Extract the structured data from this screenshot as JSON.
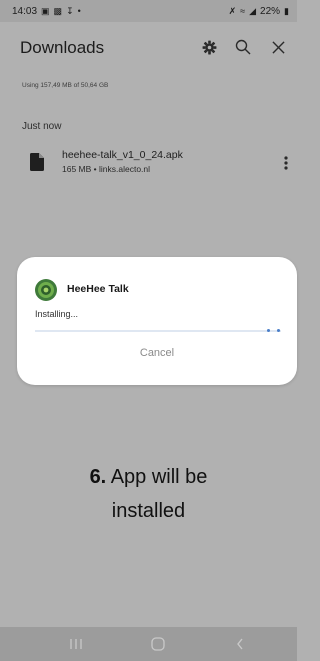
{
  "status_bar": {
    "time": "14:03",
    "battery": "22%"
  },
  "header": {
    "title": "Downloads"
  },
  "storage": {
    "text": "Using 157,49 MB of 50,64 GB"
  },
  "section": {
    "label": "Just now"
  },
  "file": {
    "name": "heehee-talk_v1_0_24.apk",
    "meta": "165 MB • links.alecto.nl"
  },
  "dialog": {
    "app_name": "HeeHee Talk",
    "status": "Installing...",
    "cancel_label": "Cancel"
  },
  "caption": {
    "number": "6.",
    "line1": "App will be",
    "line2": "installed"
  },
  "colors": {
    "dialog_bg": "#ffffff",
    "progress": "#4a7ec9",
    "overlay": "#b1b1b1"
  }
}
